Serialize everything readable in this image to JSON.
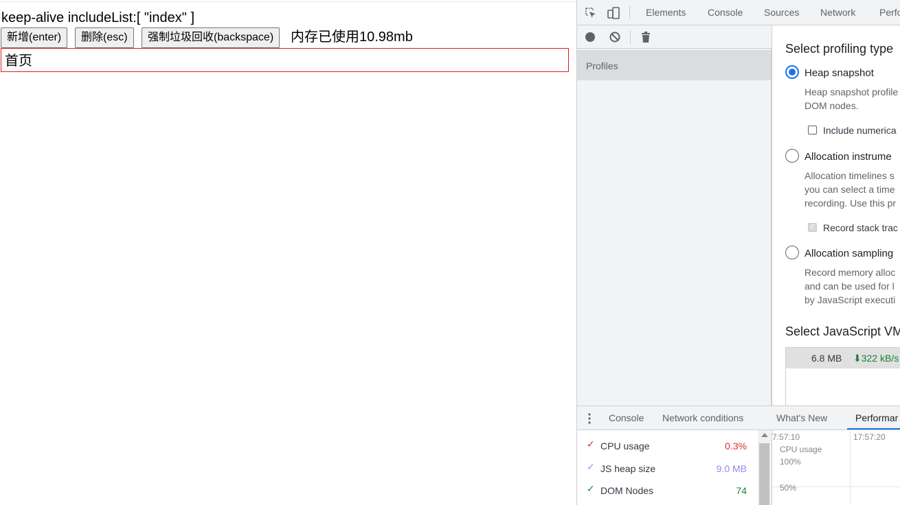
{
  "app": {
    "title": "keep-alive includeList:[ \"index\" ]",
    "buttons": {
      "add": "新增(enter)",
      "remove": "删除(esc)",
      "gc": "强制垃圾回收(backspace)"
    },
    "memory_text": "内存已使用10.98mb",
    "page_label": "首页"
  },
  "devtools": {
    "tabs": [
      "Elements",
      "Console",
      "Sources",
      "Network",
      "Perfo"
    ],
    "sidebar": {
      "profiles_label": "Profiles"
    },
    "profiling": {
      "heading": "Select profiling type",
      "heap_snapshot": {
        "label": "Heap snapshot",
        "desc1": "Heap snapshot profile",
        "desc2": "DOM nodes.",
        "checkbox_label": "Include numerica"
      },
      "allocation_instrumentation": {
        "label": "Allocation instrume",
        "desc1": "Allocation timelines s",
        "desc2": "you can select a time",
        "desc3": "recording. Use this pr",
        "checkbox_label": "Record stack trac"
      },
      "allocation_sampling": {
        "label": "Allocation sampling",
        "desc1": "Record memory alloc",
        "desc2": "and can be used for l",
        "desc3": "by JavaScript executi"
      },
      "vm_heading": "Select JavaScript VM",
      "vm_row": {
        "size": "6.8 MB",
        "rate": "⬇322 kB/s"
      }
    },
    "drawer": {
      "tabs": [
        "Console",
        "Network conditions",
        "What's New",
        "Performar"
      ]
    },
    "perf_monitor": {
      "metrics": [
        {
          "label": "CPU usage",
          "value": "0.3%",
          "color": "#d93025"
        },
        {
          "label": "JS heap size",
          "value": "9.0 MB",
          "color": "#8e8cf0"
        },
        {
          "label": "DOM Nodes",
          "value": "74",
          "color": "#188038"
        }
      ],
      "graph": {
        "time1": "7:57:10",
        "time2": "17:57:20",
        "series_label": "CPU usage",
        "tick100": "100%",
        "tick50": "50%"
      }
    }
  }
}
